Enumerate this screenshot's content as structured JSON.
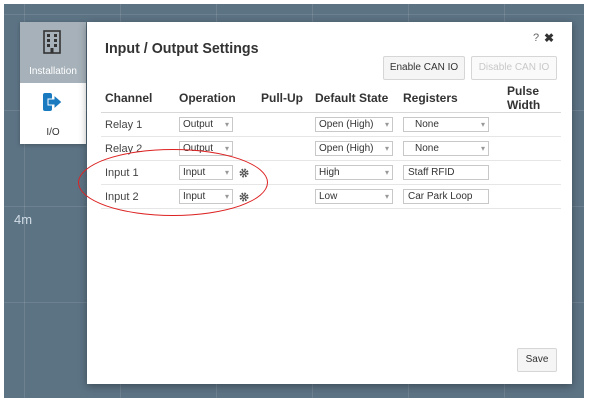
{
  "background": {
    "scale_label": "4m"
  },
  "sidebar": {
    "items": [
      {
        "label": "Installation",
        "icon": "building-icon",
        "active": true
      },
      {
        "label": "I/O",
        "icon": "sign-in-arrow-icon",
        "active": false
      }
    ]
  },
  "dialog": {
    "title": "Input / Output Settings",
    "help_label": "?",
    "close_label": "✖",
    "enable_can_label": "Enable CAN IO",
    "disable_can_label": "Disable CAN IO",
    "save_label": "Save"
  },
  "table": {
    "headers": [
      "Channel",
      "Operation",
      "Pull-Up",
      "Default State",
      "Registers",
      "Pulse Width"
    ],
    "rows": [
      {
        "channel": "Relay 1",
        "operation": "Output",
        "default_state": "Open (High)",
        "registers": "None"
      },
      {
        "channel": "Relay 2",
        "operation": "Output",
        "default_state": "Open (High)",
        "registers": "None"
      },
      {
        "channel": "Input 1",
        "operation": "Input",
        "default_state": "High",
        "registers": "Staff RFID"
      },
      {
        "channel": "Input 2",
        "operation": "Input",
        "default_state": "Low",
        "registers": "Car Park Loop"
      }
    ]
  },
  "colors": {
    "annotation_ring": "#dd2222",
    "accent": "#1a7abf"
  }
}
